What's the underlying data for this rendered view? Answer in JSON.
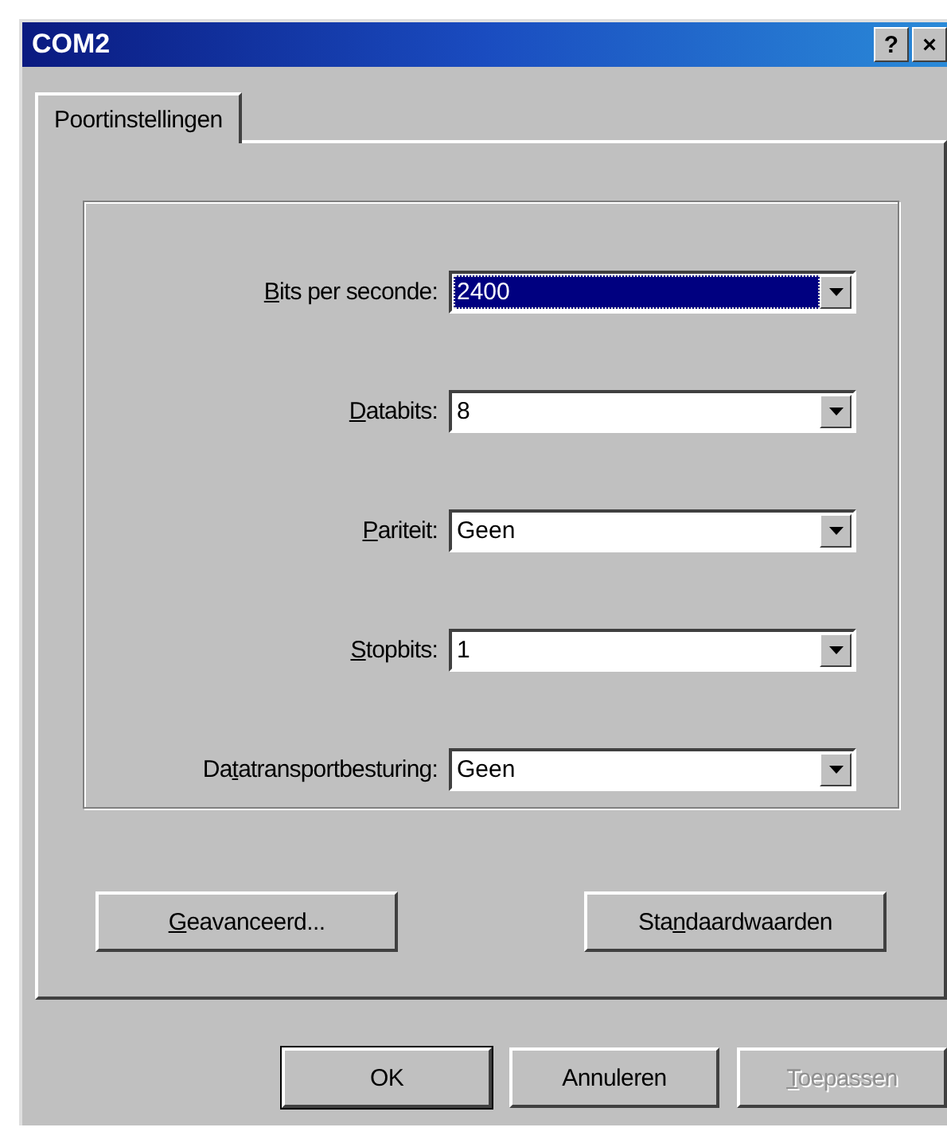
{
  "window": {
    "title": "COM2",
    "title_buttons": [
      "?",
      "×"
    ]
  },
  "tabs": [
    {
      "label": "Poortinstellingen",
      "selected": true
    }
  ],
  "fields": [
    {
      "label": {
        "accesskey": "B",
        "rest": "its per seconde:"
      },
      "value": "2400",
      "focused": true
    },
    {
      "label": {
        "accesskey": "D",
        "rest": "atabits:"
      },
      "value": "8",
      "focused": false
    },
    {
      "label": {
        "accesskey": "P",
        "rest": "ariteit:"
      },
      "value": "Geen",
      "focused": false
    },
    {
      "label": {
        "accesskey": "S",
        "rest": "topbits:"
      },
      "value": "1",
      "focused": false
    },
    {
      "label": {
        "start": "Da",
        "accesskey": "t",
        "rest": "atransportbesturing:"
      },
      "value": "Geen",
      "focused": false
    }
  ],
  "panel_buttons": [
    {
      "label": {
        "accesskey": "G",
        "rest": "eavanceerd..."
      },
      "disabled": false,
      "default": false
    },
    {
      "label": {
        "start": "Sta",
        "accesskey": "n",
        "rest": "daardwaarden"
      },
      "disabled": false,
      "default": false
    }
  ],
  "dialog_buttons": [
    {
      "label": {
        "rest": "OK"
      },
      "disabled": false,
      "default": true
    },
    {
      "label": {
        "rest": "Annuleren"
      },
      "disabled": false,
      "default": false
    },
    {
      "label": {
        "accesskey": "T",
        "rest": "oepassen"
      },
      "disabled": true,
      "default": false
    }
  ]
}
